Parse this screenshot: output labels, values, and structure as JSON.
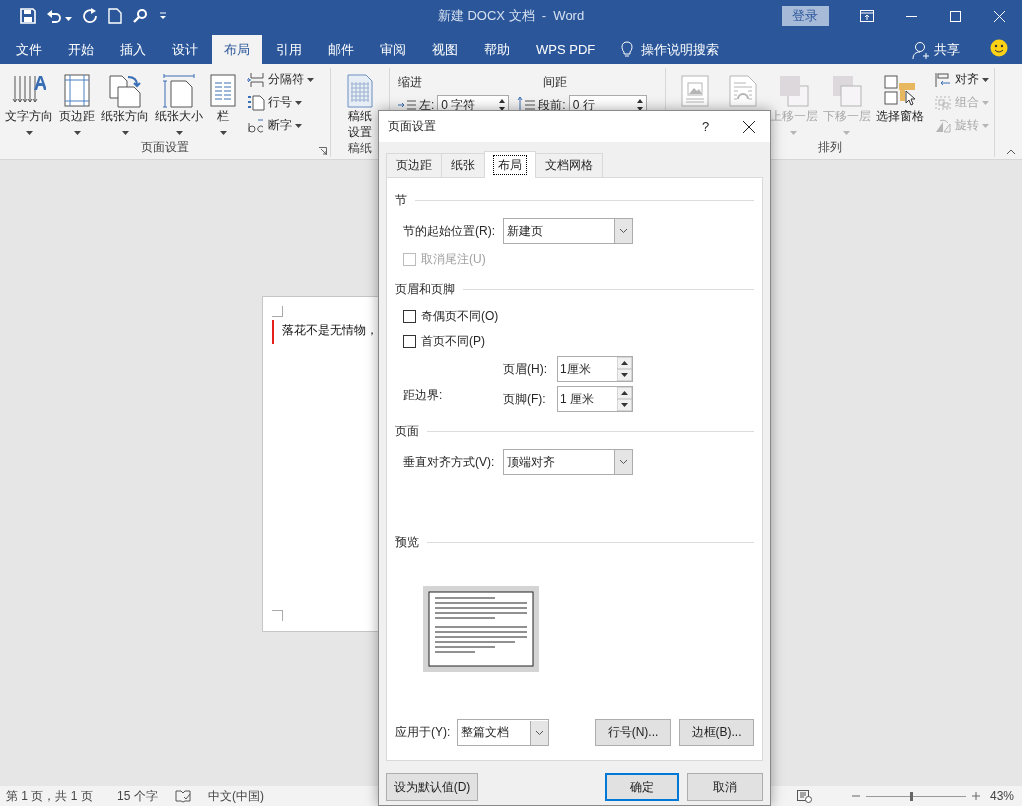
{
  "window": {
    "title": "新建 DOCX 文档  -  Word",
    "sign_in": "登录"
  },
  "tabs": [
    {
      "label": "文件",
      "selected": false
    },
    {
      "label": "开始",
      "selected": false
    },
    {
      "label": "插入",
      "selected": false
    },
    {
      "label": "设计",
      "selected": false
    },
    {
      "label": "布局",
      "selected": true
    },
    {
      "label": "引用",
      "selected": false
    },
    {
      "label": "邮件",
      "selected": false
    },
    {
      "label": "审阅",
      "selected": false
    },
    {
      "label": "视图",
      "selected": false
    },
    {
      "label": "帮助",
      "selected": false
    },
    {
      "label": "WPS PDF",
      "selected": false
    }
  ],
  "tell_me": "操作说明搜索",
  "share": "共享",
  "ribbon": {
    "page_setup": {
      "label": "页面设置",
      "large_buttons": [
        {
          "label": "文字方向"
        },
        {
          "label": "页边距"
        },
        {
          "label": "纸张方向"
        },
        {
          "label": "纸张大小"
        },
        {
          "label": "栏"
        }
      ],
      "small_buttons": [
        {
          "label": "分隔符"
        },
        {
          "label": "行号"
        },
        {
          "label": "断字"
        }
      ]
    },
    "draft": {
      "label": "稿纸",
      "button": "稿纸设置"
    },
    "paragraph": {
      "indent_heading": "缩进",
      "indent_left": {
        "label": "左:",
        "value": "0 字符"
      },
      "spacing_heading": "间距",
      "spacing_before": {
        "label": "段前:",
        "value": "0 行"
      }
    },
    "arrange": {
      "label": "排列",
      "large_buttons": [
        {
          "disabled": true
        },
        {
          "disabled": true
        },
        {
          "label": "上移一层",
          "disabled": true
        },
        {
          "label": "下移一层",
          "disabled": true
        },
        {
          "label": "选择窗格",
          "disabled": false
        }
      ],
      "small_buttons": [
        {
          "label": "对齐",
          "disabled": false
        },
        {
          "label": "组合",
          "disabled": true
        },
        {
          "label": "旋转",
          "disabled": true
        }
      ]
    }
  },
  "document": {
    "text": "落花不是无情物，"
  },
  "status_bar": {
    "page": "第 1 页，共 1 页",
    "words": "15 个字",
    "language": "中文(中国)",
    "zoom_slider": {
      "level": 0.45
    },
    "zoom": "43%"
  },
  "dialog": {
    "title": "页面设置",
    "help": "?",
    "tabs": [
      {
        "label": "页边距",
        "selected": false
      },
      {
        "label": "纸张",
        "selected": false
      },
      {
        "label": "布局",
        "selected": true
      },
      {
        "label": "文档网格",
        "selected": false
      }
    ],
    "section": {
      "heading": "节",
      "start_label": "节的起始位置(R):",
      "start_value": "新建页",
      "suppress_endnotes": {
        "label": "取消尾注(U)",
        "checked": false,
        "disabled": true
      }
    },
    "header_footer": {
      "heading": "页眉和页脚",
      "checkboxes": [
        {
          "label": "奇偶页不同(O)",
          "checked": false,
          "disabled": false
        },
        {
          "label": "首页不同(P)",
          "checked": false,
          "disabled": false
        }
      ],
      "from_edge_label": "距边界:",
      "header": {
        "label": "页眉(H):",
        "value": "1厘米"
      },
      "footer": {
        "label": "页脚(F):",
        "value": "1 厘米"
      }
    },
    "page": {
      "heading": "页面",
      "vertical_label": "垂直对齐方式(V):",
      "vertical_value": "顶端对齐"
    },
    "preview": {
      "heading": "预览"
    },
    "apply_label": "应用于(Y):",
    "apply_value": "整篇文档",
    "panel_buttons": [
      "行号(N)...",
      "边框(B)..."
    ],
    "footer_buttons": [
      {
        "label": "设为默认值(D)",
        "kind": "default"
      },
      {
        "label": "确定",
        "kind": "primary"
      },
      {
        "label": "取消",
        "kind": "normal"
      }
    ]
  }
}
